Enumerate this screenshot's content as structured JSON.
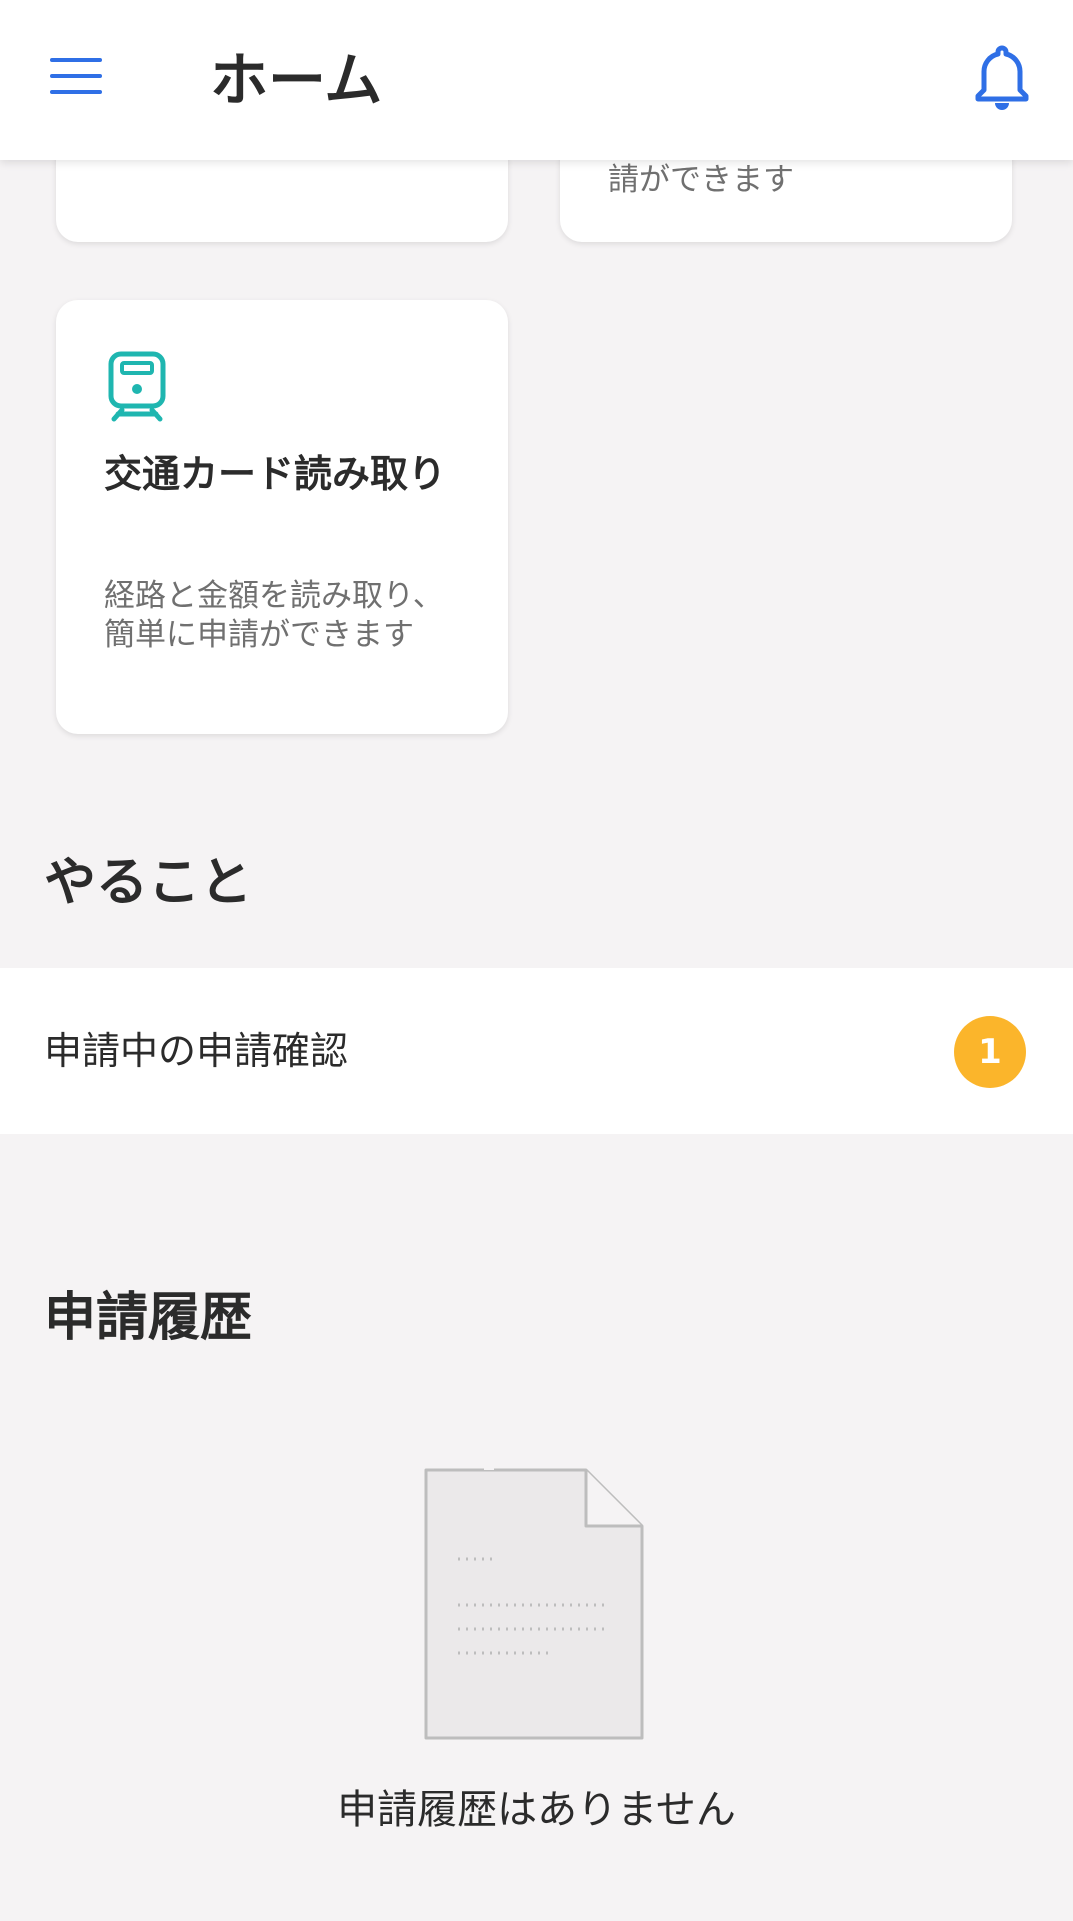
{
  "header": {
    "title": "ホーム",
    "menu_icon": "hamburger-menu-icon",
    "notification_icon": "bell-icon",
    "accent_color": "#2f6fe6"
  },
  "cards": {
    "top_right_desc": "請ができます",
    "transit_card": {
      "icon": "train-icon",
      "icon_color": "#1fb6b0",
      "title": "交通カード読み取り",
      "description": "経路と金額を読み取り、簡単に申請ができます"
    }
  },
  "todo": {
    "section_title": "やること",
    "items": [
      {
        "label": "申請中の申請確認",
        "badge": "1",
        "badge_color": "#fbb52b"
      }
    ]
  },
  "history": {
    "section_title": "申請履歴",
    "empty_icon": "empty-document-icon",
    "empty_text": "申請履歴はありません"
  }
}
